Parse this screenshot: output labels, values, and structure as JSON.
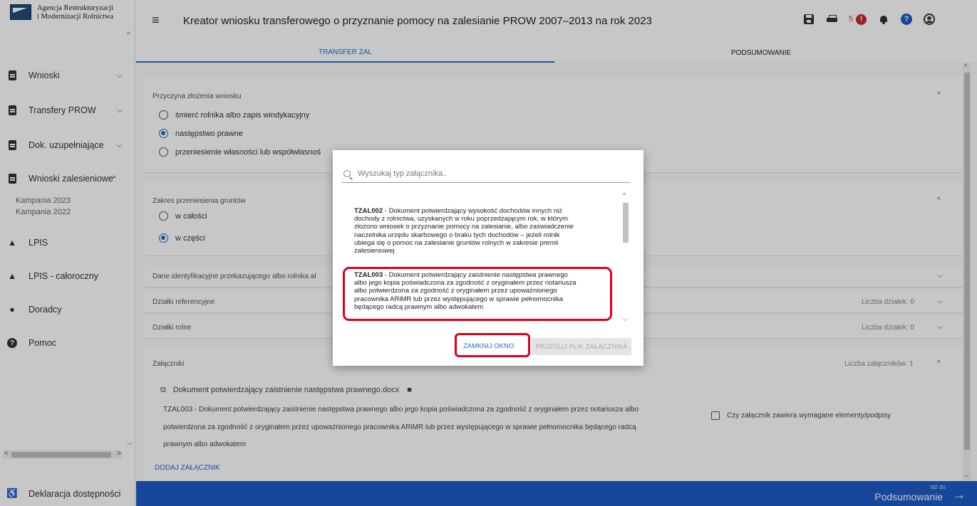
{
  "sidebar": {
    "logo_line1": "Agencja Restrukturyzacji",
    "logo_line2": "i Modernizacji Rolnictwa",
    "items": [
      {
        "label": "Wnioski",
        "icon": "document-icon"
      },
      {
        "label": "Transfery PROW",
        "icon": "document-icon"
      },
      {
        "label": "Dok. uzupełniające",
        "icon": "document-icon"
      },
      {
        "label": "Wnioski zalesieniowe",
        "icon": "document-icon"
      },
      {
        "label": "LPIS",
        "icon": "mountain-icon"
      },
      {
        "label": "LPIS - całoroczny",
        "icon": "mountain-icon"
      },
      {
        "label": "Doradcy",
        "icon": "person-icon"
      },
      {
        "label": "Pomoc",
        "icon": "help-icon"
      }
    ],
    "subitems": [
      "Kampania 2023",
      "Kampania 2022"
    ],
    "footer_label": "Deklaracja dostępności"
  },
  "header": {
    "title": "Kreator wniosku transferowego o przyznanie pomocy na zalesianie PROW 2007–2013 na rok 2023",
    "notification_count": "5",
    "alert_symbol": "!",
    "help_symbol": "?"
  },
  "tabs": [
    {
      "label": "TRANSFER ZAL",
      "active": true
    },
    {
      "label": "PODSUMOWANIE",
      "active": false
    }
  ],
  "form": {
    "reason": {
      "label": "Przyczyna złożenia wniosku",
      "options": [
        {
          "label": "śmierć rolnika albo zapis windykacyjny",
          "selected": false
        },
        {
          "label": "następstwo prawne",
          "selected": true
        },
        {
          "label": "przeniesienie własności lub współwłasnoś",
          "selected": false
        }
      ]
    },
    "scope": {
      "label": "Zakres przeniesienia gruntów",
      "options": [
        {
          "label": "w całości",
          "selected": false
        },
        {
          "label": "w części",
          "selected": true
        }
      ]
    },
    "sections": [
      {
        "label": "Dane identyfikacyjne przekazującego albo rolnika al",
        "info": ""
      },
      {
        "label": "Działki referencyjne",
        "info": "Liczba działek: 0"
      },
      {
        "label": "Działki rolne",
        "info": "Liczba działek: 0"
      }
    ],
    "attachments": {
      "label": "Załączniki",
      "count_info": "Liczba załączników: 1",
      "file_name": "Dokument potwierdzający zaistnienie następstwa prawnego.docx",
      "desc_line1": "TZAL003 - Dokument potwierdzający zaistnienie następstwa prawnego albo jego kopia poświadczona za zgodność z oryginałem przez notariusza albo",
      "desc_line2": "potwierdzona za zgodność z oryginałem przez upoważnionego pracownika ARiMR lub przez występującego w sprawie pełnomocnika będącego radcą",
      "desc_line3": "prawnym albo adwokatem",
      "checkbox_label": "Czy załącznik zawiera wymagane elementy/podpisy",
      "add_label": "DODAJ ZAŁĄCZNIK"
    }
  },
  "footer": {
    "small": "Idź do",
    "big": "Podsumowanie"
  },
  "modal": {
    "search_placeholder": "Wyszukaj typ załącznika..",
    "options": [
      {
        "code": "TZAL002",
        "lines": [
          " - Dokument potwierdzający wysokość dochodów innych niż",
          "dochody z rolnictwa, uzyskanych w roku poprzedzającym rok, w którym",
          "złożono wniosek o przyznanie pomocy na zalesianie, albo zaświadczenie",
          "naczelnika urzędu skarbowego o braku tych dochodów – jeżeli rolnik",
          "ubiega się o pomoc na zalesianie gruntów rolnych w zakresie premii",
          "zalesieniowej"
        ]
      },
      {
        "code": "TZAL003",
        "lines": [
          " - Dokument potwierdzający zaistnienie następstwa prawnego",
          "albo jego kopia poświadczona za zgodność z oryginałem przez notariusza",
          "albo potwierdzona za zgodność z oryginałem przez upoważnionego",
          "pracownika ARiMR lub przez występującego w sprawie pełnomocnika",
          "będącego radcą prawnym albo adwokatem"
        ]
      }
    ],
    "close_label": "ZAMKNIJ OKNO",
    "upload_label": "PRZEŚLIJ PLIK ZAŁĄCZNIKA"
  },
  "colors": {
    "accent": "#1e6fc7",
    "footer_bar": "#1e5bc6",
    "highlight": "#e0001a",
    "alert": "#c62828"
  }
}
